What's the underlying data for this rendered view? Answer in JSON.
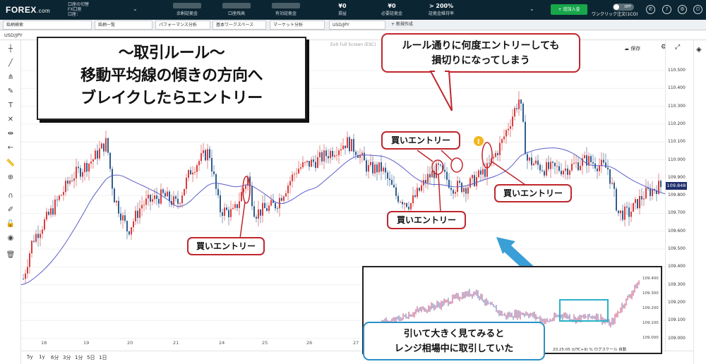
{
  "header": {
    "logo": "FOREX",
    "logo_suffix": ".com",
    "account_line1": "口座の切替",
    "account_line2": "FX口座",
    "account_line3": "口座：",
    "stats": [
      {
        "label": "余剰証拠金",
        "value": ""
      },
      {
        "label": "口座残高",
        "value": ""
      },
      {
        "label": "有効証拠金",
        "value": ""
      },
      {
        "label": "損益",
        "value": "¥0"
      },
      {
        "label": "必要証拠金",
        "value": "¥0"
      },
      {
        "label": "証拠金維持率",
        "value": "> 200%"
      }
    ],
    "deposit_label": "+ 追加入金",
    "oneclick_label": "ワンクリック注文(1CO)",
    "toggle_label": "OFF"
  },
  "tabs": [
    "銘柄検索",
    "銘柄一覧",
    "パフォーマンス分析",
    "基本ワークスペース",
    "マーケット分析",
    "USD/JPY",
    "+ 新規作成"
  ],
  "symbol": "USD/JPY",
  "chart_toolbar": {
    "exit_fullscreen": "Exit Full Screen (ESC)",
    "save": "保存"
  },
  "chart_data": {
    "type": "candlestick",
    "symbol": "USD/JPY",
    "y_ticks": [
      110.5,
      110.4,
      110.3,
      110.2,
      110.1,
      110.0,
      109.9,
      109.8,
      109.7,
      109.6,
      109.5,
      109.4,
      109.3,
      109.2,
      109.1,
      109.0
    ],
    "ylim": [
      108.95,
      110.6
    ],
    "x_ticks": [
      "18",
      "19",
      "20",
      "21",
      "24",
      "25",
      "26",
      "27"
    ],
    "last_price": "109.848",
    "moving_average": {
      "name": "moving average",
      "color": "#5b5fc7"
    },
    "colors": {
      "up": "#d93c3c",
      "down": "#2f5e8f"
    },
    "inset": {
      "y_ticks": [
        109.4,
        109.3,
        109.2,
        109.1,
        109.0
      ],
      "time_label": "20:25:05 (UTC+9)",
      "scale_modes": [
        "%",
        "ログスケール",
        "自動"
      ]
    }
  },
  "annotations": {
    "rule_title": "～取引ルール～",
    "rule_line2": "移動平均線の傾きの方向へ",
    "rule_line3": "ブレイクしたらエントリー",
    "note_line1": "ルール通りに何度エントリーしても",
    "note_line2": "損切りになってしまう",
    "buy_label": "買いエントリー",
    "inset_line1": "引いて大きく見てみると",
    "inset_line2": "レンジ相場中に取引していた"
  },
  "timeframes": [
    "5y",
    "1y",
    "6分",
    "3分",
    "1分",
    "5日",
    "1日"
  ]
}
